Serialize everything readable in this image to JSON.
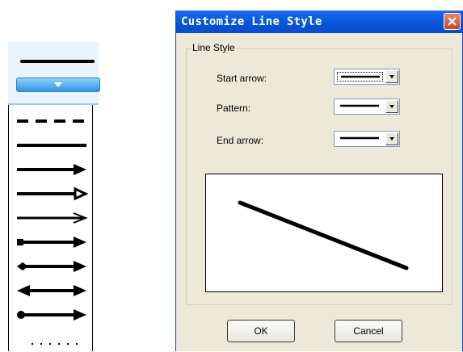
{
  "dialog": {
    "title": "Customize Line Style",
    "group_label": "Line Style",
    "fields": {
      "start_arrow": {
        "label": "Start arrow:"
      },
      "pattern": {
        "label": "Pattern:"
      },
      "end_arrow": {
        "label": "End arrow:"
      }
    },
    "ok_label": "OK",
    "cancel_label": "Cancel"
  },
  "picker": {
    "items": [
      "dash",
      "solid",
      "arrow-end",
      "open-arrow-end",
      "thin-arrow-end",
      "square-start-arrow-end",
      "diamond-start-arrow-end",
      "arrows-both",
      "dot-start-arrow-end",
      "dotted"
    ]
  },
  "colors": {
    "titlebar": "#0a5ce0",
    "close_button": "#c8451f",
    "dialog_face": "#ece9d8",
    "picker_accent": "#2f97e3"
  },
  "icons": {
    "close": "close-icon",
    "dropdown": "chevron-down-icon"
  }
}
